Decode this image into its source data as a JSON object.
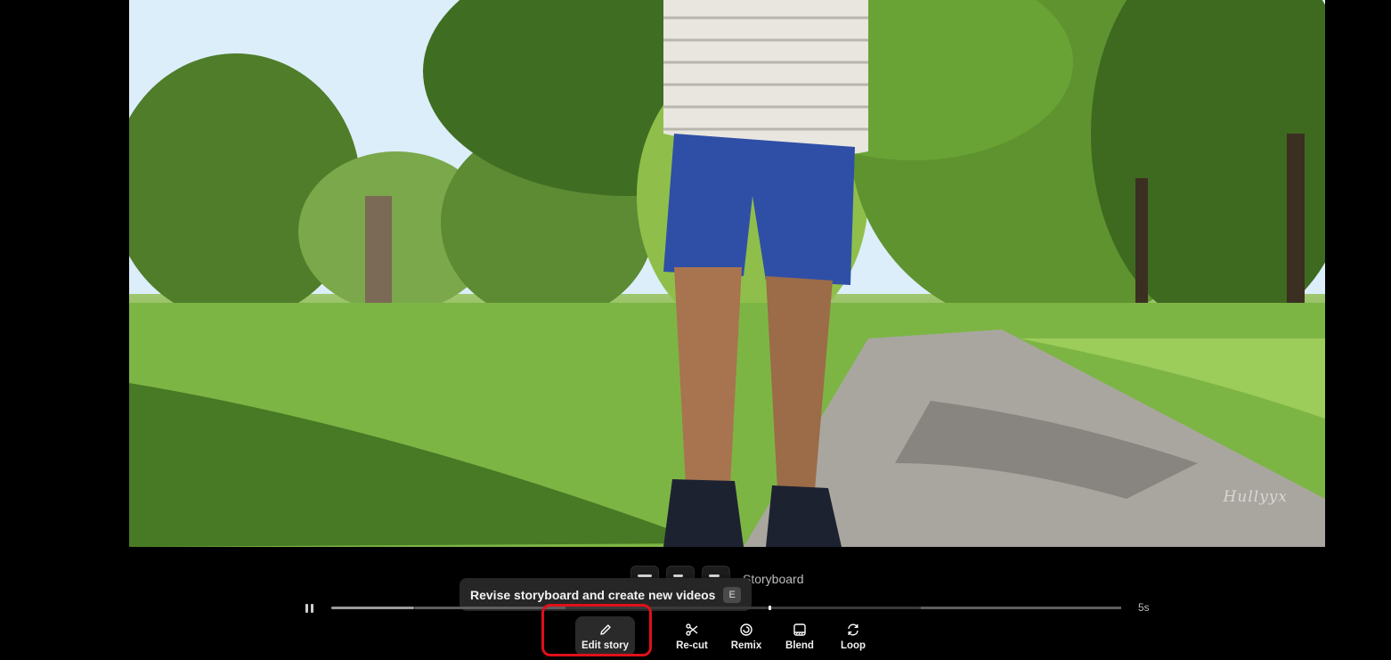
{
  "video": {
    "watermark": "Hullyyx"
  },
  "storyboard": {
    "label": "Storyboard",
    "thumbnails": 3
  },
  "tooltip": {
    "text": "Revise storyboard and create new videos",
    "shortcut": "E"
  },
  "playback": {
    "duration": "5s",
    "progress_fraction": 0.554,
    "segments": [
      0.0,
      0.106,
      0.296,
      0.746,
      1.0
    ]
  },
  "toolbar": {
    "items": [
      {
        "label": "Edit story",
        "icon": "pencil-icon",
        "active": true
      },
      {
        "label": "Re-cut",
        "icon": "scissors-icon",
        "active": false
      },
      {
        "label": "Remix",
        "icon": "remix-icon",
        "active": false
      },
      {
        "label": "Blend",
        "icon": "blend-icon",
        "active": false
      },
      {
        "label": "Loop",
        "icon": "loop-icon",
        "active": false
      }
    ]
  },
  "colors": {
    "highlight": "#e0101a",
    "background": "#000000"
  }
}
